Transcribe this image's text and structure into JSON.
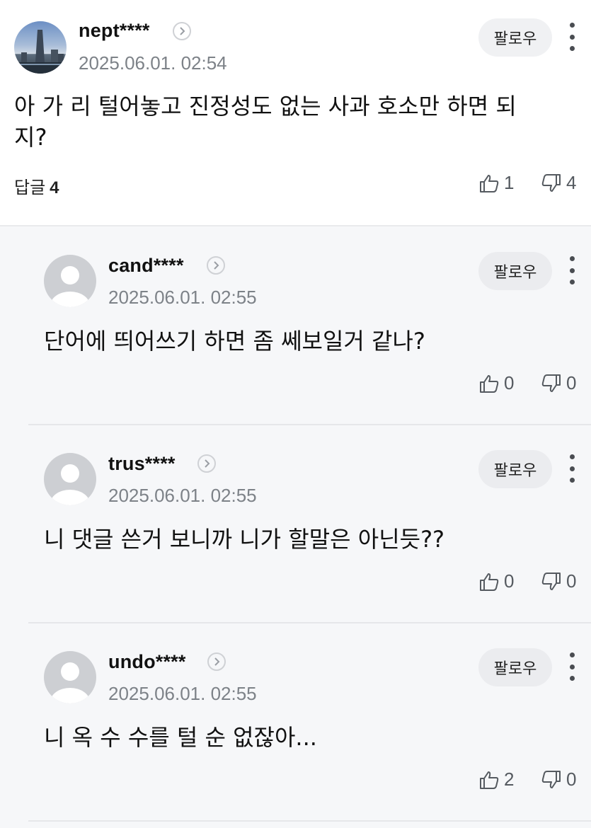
{
  "comment": {
    "username": "nept****",
    "date": "2025.06.01. 02:54",
    "follow_label": "팔로우",
    "text_line1": "아 가 리 털어놓고 진정성도 없는 사과 호소만 하면 되",
    "text_line2": "지?",
    "reply_label": "답글",
    "reply_count": "4",
    "likes": "1",
    "dislikes": "4"
  },
  "replies": [
    {
      "username": "cand****",
      "date": "2025.06.01. 02:55",
      "follow_label": "팔로우",
      "text": "단어에 띄어쓰기 하면 좀 쎄보일거 같나?",
      "likes": "0",
      "dislikes": "0"
    },
    {
      "username": "trus****",
      "date": "2025.06.01. 02:55",
      "follow_label": "팔로우",
      "text": "니 댓글 쓴거 보니까 니가 할말은 아닌듯??",
      "likes": "0",
      "dislikes": "0"
    },
    {
      "username": "undo****",
      "date": "2025.06.01. 02:55",
      "follow_label": "팔로우",
      "text": "니 옥 수 수를 털 순 없잖아...",
      "likes": "2",
      "dislikes": "0"
    }
  ],
  "icons": {
    "more": "more-vertical-icon",
    "chevron": "chevron-right-icon",
    "like": "thumbs-up-icon",
    "dislike": "thumbs-down-icon",
    "default_avatar": "default-avatar-icon"
  }
}
